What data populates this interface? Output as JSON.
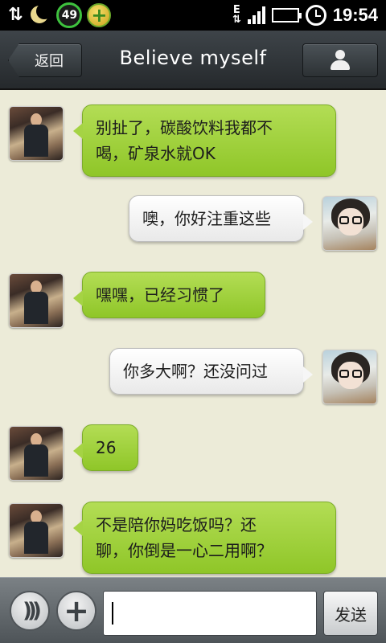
{
  "status_bar": {
    "sync_glyph": "⇅",
    "badge_value": "49",
    "network_type": "E",
    "network_arrows": "⇅",
    "time": "19:54"
  },
  "header": {
    "back_label": "返回",
    "title": "Believe myself"
  },
  "messages": [
    {
      "sender": "other",
      "text_line1": "别扯了，碳酸饮料我都不",
      "text_line2": "喝，矿泉水就OK"
    },
    {
      "sender": "self",
      "text_line1": "噢，你好注重这些"
    },
    {
      "sender": "other",
      "text_line1": "嘿嘿，已经习惯了"
    },
    {
      "sender": "self",
      "text_line1": "你多大啊？还没问过"
    },
    {
      "sender": "other",
      "text_line1": "26"
    },
    {
      "sender": "other",
      "text_line1": "不是陪你妈吃饭吗？还",
      "text_line2": "聊，你倒是一心二用啊？"
    }
  ],
  "input_bar": {
    "input_value": "",
    "send_label": "发送"
  },
  "colors": {
    "incoming_bubble": "#a5d344",
    "outgoing_bubble": "#f6f6f6",
    "background": "#ecebd8"
  }
}
